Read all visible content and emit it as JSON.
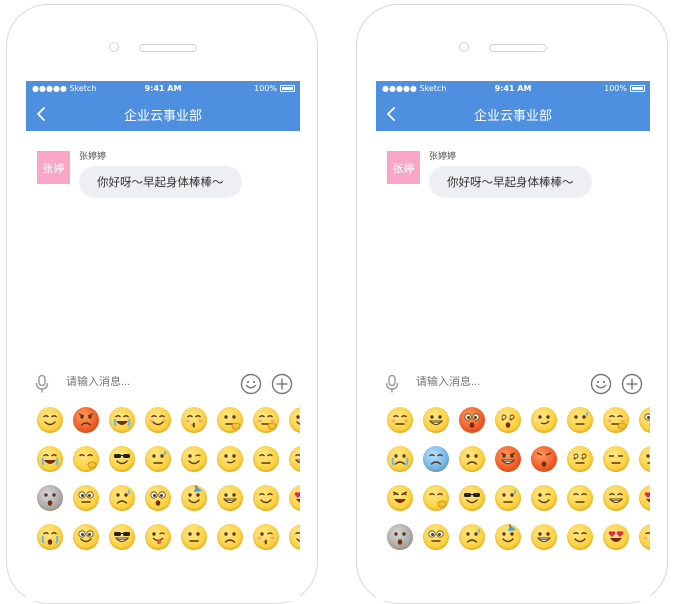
{
  "phones": [
    {
      "status": {
        "carrier": "●●●●● Sketch",
        "time": "9:41 AM",
        "battery": "100%"
      },
      "nav": {
        "title": "企业云事业部"
      },
      "message": {
        "avatar_text": "张婷",
        "sender": "张婷婷",
        "text": "你好呀～早起身体棒棒～"
      },
      "input": {
        "placeholder": "请输入消息..."
      },
      "emojis": [
        "happy-emoji",
        "angry-emoji",
        "laugh-tears-emoji",
        "blush-emoji",
        "kiss-emoji",
        "thinking-emoji",
        "shy-emoji",
        "slight-smile-emoji",
        "cry-emoji",
        "facepalm-emoji",
        "sunglasses-emoji",
        "sweat-emoji",
        "wink-emoji",
        "smirk-emoji",
        "sleepy-emoji",
        "grin-emoji",
        "ghost-emoji",
        "rolling-eyes-emoji",
        "worried-emoji",
        "surprised-emoji",
        "party-emoji",
        "big-grin-emoji",
        "smile-emoji",
        "heart-eyes-emoji",
        "sobbing-emoji",
        "beaming-emoji",
        "cool-emoji",
        "tongue-emoji",
        "neutral-emoji",
        "sad-emoji",
        "blushing-kiss-emoji",
        "hug-emoji"
      ]
    },
    {
      "status": {
        "carrier": "●●●●● Sketch",
        "time": "9:41 AM",
        "battery": "100%"
      },
      "nav": {
        "title": "企业云事业部"
      },
      "message": {
        "avatar_text": "张婷",
        "sender": "张婷婷",
        "text": "你好呀～早起身体棒棒～"
      },
      "input": {
        "placeholder": "请输入消息..."
      },
      "emojis": [
        "squint-emoji",
        "grimace-emoji",
        "scream-emoji",
        "dizzy-emoji",
        "smirk-emoji",
        "nervous-emoji",
        "shy-emoji",
        "shocked-emoji",
        "tears-emoji",
        "sick-emoji",
        "sad-emoji",
        "furious-emoji",
        "exploding-emoji",
        "spiral-eyes-emoji",
        "unamused-emoji",
        "meh-emoji",
        "yelling-emoji",
        "facepalm-emoji",
        "sunglasses-emoji",
        "sweat-emoji",
        "wink-emoji",
        "sleepy-emoji",
        "grin-emoji",
        "crying-emoji",
        "ghost-emoji",
        "rolling-eyes-emoji",
        "worried-emoji",
        "party-emoji",
        "big-grin-emoji",
        "smile-emoji",
        "heart-eyes-emoji",
        "kiss-emoji"
      ]
    }
  ],
  "colors": {
    "accent": "#4e8fe0",
    "avatar": "#f7a6c6",
    "bubble": "#eeeff3"
  }
}
